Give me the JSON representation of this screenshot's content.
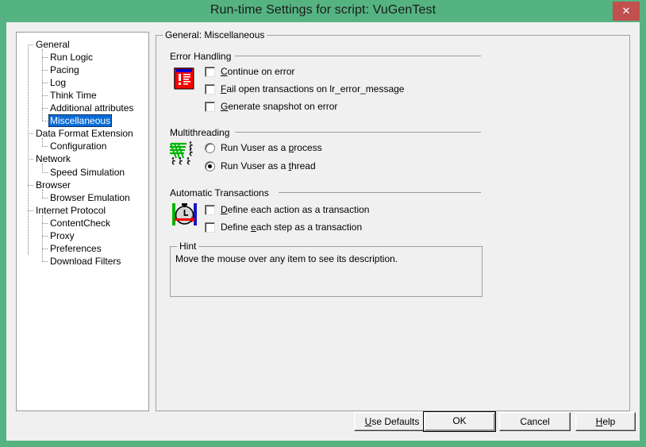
{
  "window": {
    "title": "Run-time Settings for script: VuGenTest",
    "close_label": "✕",
    "titlebar_color": "#55b381",
    "accent_color": "#c1504e"
  },
  "tree": {
    "items": [
      {
        "label": "General",
        "level": 0,
        "selected": false
      },
      {
        "label": "Run Logic",
        "level": 1,
        "selected": false
      },
      {
        "label": "Pacing",
        "level": 1,
        "selected": false
      },
      {
        "label": "Log",
        "level": 1,
        "selected": false
      },
      {
        "label": "Think Time",
        "level": 1,
        "selected": false
      },
      {
        "label": "Additional attributes",
        "level": 1,
        "selected": false
      },
      {
        "label": "Miscellaneous",
        "level": 1,
        "selected": true
      },
      {
        "label": "Data Format Extension",
        "level": 0,
        "selected": false
      },
      {
        "label": "Configuration",
        "level": 1,
        "selected": false
      },
      {
        "label": "Network",
        "level": 0,
        "selected": false
      },
      {
        "label": "Speed Simulation",
        "level": 1,
        "selected": false
      },
      {
        "label": "Browser",
        "level": 0,
        "selected": false
      },
      {
        "label": "Browser Emulation",
        "level": 1,
        "selected": false
      },
      {
        "label": "Internet Protocol",
        "level": 0,
        "selected": false
      },
      {
        "label": "ContentCheck",
        "level": 1,
        "selected": false
      },
      {
        "label": "Proxy",
        "level": 1,
        "selected": false
      },
      {
        "label": "Preferences",
        "level": 1,
        "selected": false
      },
      {
        "label": "Download Filters",
        "level": 1,
        "selected": false
      }
    ],
    "selection_color": "#0a6bd6"
  },
  "main": {
    "group_title": "General: Miscellaneous",
    "sections": {
      "error_handling": {
        "title": "Error Handling",
        "icon": "error-document-icon",
        "options": [
          {
            "label": "Continue on error",
            "accel": "C",
            "checked": false
          },
          {
            "label": "Fail open transactions on lr_error_message",
            "accel": "F",
            "checked": false
          },
          {
            "label": "Generate snapshot on error",
            "accel": "G",
            "checked": false
          }
        ]
      },
      "multithreading": {
        "title": "Multithreading",
        "icon": "threads-runners-icon",
        "options": [
          {
            "label": "Run Vuser as a process",
            "accel": "p",
            "checked": false
          },
          {
            "label": "Run Vuser as a thread",
            "accel": "t",
            "checked": true
          }
        ]
      },
      "automatic_transactions": {
        "title": "Automatic Transactions",
        "icon": "stopwatch-arrow-icon",
        "options": [
          {
            "label": "Define each action as a transaction",
            "accel": "D",
            "checked": false
          },
          {
            "label": "Define each step as a transaction",
            "accel": "e",
            "checked": false
          }
        ]
      }
    },
    "hint": {
      "title": "Hint",
      "text": "Move the mouse over any item to see its description."
    }
  },
  "buttons": {
    "use_defaults": {
      "label_pre": "U",
      "label_post": "se Defaults"
    },
    "ok": {
      "label": "OK"
    },
    "cancel": {
      "label": "Cancel"
    },
    "help": {
      "label_pre": "H",
      "label_post": "elp"
    }
  }
}
